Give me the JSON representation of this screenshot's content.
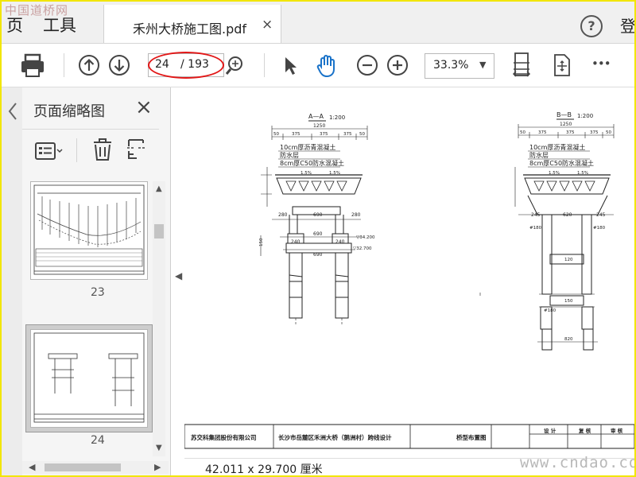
{
  "watermark_top": "中国道桥网",
  "watermark_bottom": "www.cndao.com",
  "menu": {
    "page": "页",
    "tools": "工具"
  },
  "tab": {
    "title": "禾州大桥施工图.pdf",
    "close": "×"
  },
  "header": {
    "help": "?",
    "login": "登"
  },
  "toolbar": {
    "current_page": "24",
    "total_pages": "/ 193",
    "zoom": "33.3%",
    "more": "•••"
  },
  "sidebar": {
    "title": "页面缩略图",
    "close": "×",
    "thumbnails": [
      {
        "page": "23"
      },
      {
        "page": "24"
      }
    ]
  },
  "document": {
    "section_a": "A—A",
    "section_a_scale": "1:200",
    "section_b": "B—B",
    "section_b_scale": "1:200",
    "layer1": "10cm厚沥青混凝土",
    "layer2": "防水层",
    "layer3": "8cm厚C50防水混凝土",
    "dim_total": "1250",
    "dim_sub": [
      "50",
      "375",
      "375",
      "375",
      "50"
    ],
    "slope": "1.5%",
    "dim_280": "280",
    "dim_690": "690",
    "dim_620": "620",
    "dim_245": "245",
    "dim_240": "240",
    "dim_150": "150",
    "dim_120": "120",
    "dim_180": "#180",
    "dim_820": "820",
    "elev1": "▽34.200",
    "elev2": "▽32.700",
    "titleblock": {
      "company": "苏交科集团股份有限公司",
      "project": "长沙市岳麓区禾洲大桥（鹅洲村）跨线设计",
      "drawing": "桥型布置图",
      "design": "设 计",
      "review": "复 核",
      "check": "审 核"
    }
  },
  "status": {
    "size": "42.011 x 29.700 厘米"
  },
  "colors": {
    "highlight": "#e21818",
    "frame": "#f2e600",
    "hand_tool": "#1a73c9"
  }
}
